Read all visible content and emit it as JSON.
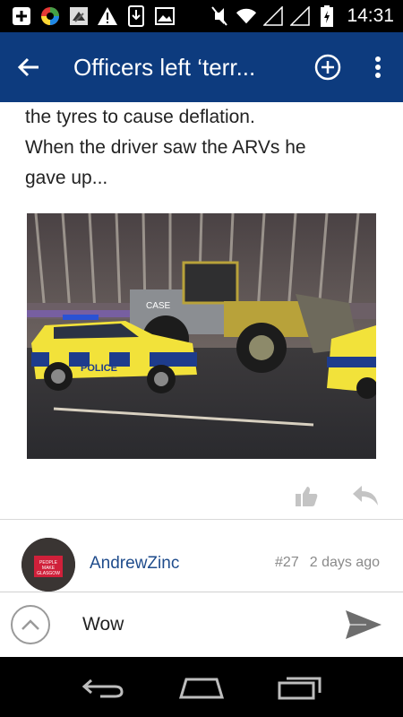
{
  "status_bar": {
    "time": "14:31",
    "icons": [
      "plus-box-icon",
      "colorful-app-icon",
      "news-app-icon",
      "warning-icon",
      "download-icon",
      "image-icon",
      "mute-icon",
      "wifi-icon",
      "signal-icon",
      "signal-icon",
      "battery-charging-icon"
    ]
  },
  "app_bar": {
    "title": "Officers left ‘terr...",
    "color": "#0d3b7e"
  },
  "post": {
    "lines": [
      "the tyres to cause deflation.",
      "When the driver saw the ARVs he",
      "gave up..."
    ],
    "photo": {
      "vehicle_label": "POLICE",
      "machine_label": "CASE"
    }
  },
  "author": {
    "name": "AndrewZinc",
    "post_number": "#27",
    "time_ago": "2 days ago",
    "avatar_text": "PEOPLE MAKE GLASGOW"
  },
  "composer": {
    "value": "Wow"
  }
}
